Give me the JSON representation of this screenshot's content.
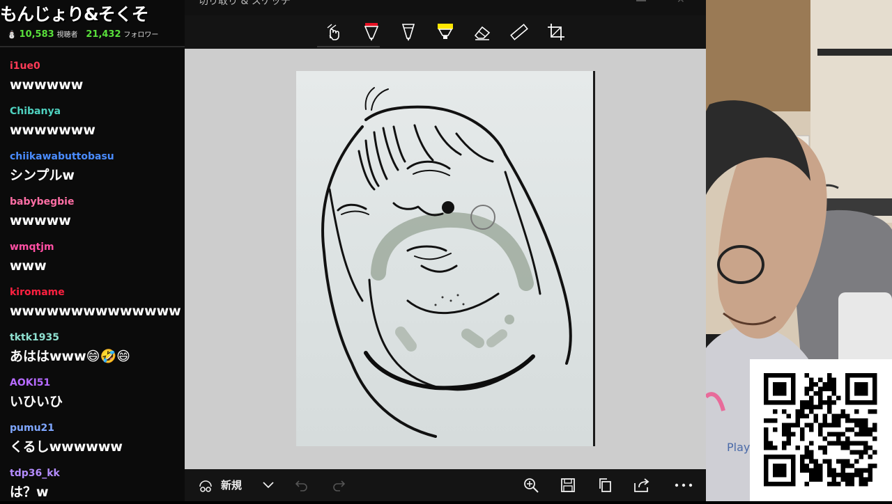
{
  "stream": {
    "title": "もんじょり&そくそ",
    "viewers": "10,583",
    "viewers_label": "視聴者",
    "followers": "21,432",
    "followers_label": "フォロワー"
  },
  "chat": [
    {
      "user": "i1ue0",
      "text": "wwwwww",
      "color": "#ff3b57"
    },
    {
      "user": "Chibanya",
      "text": "wwwwwww",
      "color": "#4fd2c0"
    },
    {
      "user": "chiikawabuttobasu",
      "text": "シンプルw",
      "color": "#4a8cff"
    },
    {
      "user": "babybegbie",
      "text": "wwwww",
      "color": "#ff6fa5"
    },
    {
      "user": "wmqtjm",
      "text": "www",
      "color": "#ff4fa3"
    },
    {
      "user": "kiromame",
      "text": "wwwwwwwwwwwwww",
      "color": "#ff2040"
    },
    {
      "user": "tktk1935",
      "text": "あははwww😄🤣😄",
      "color": "#8fe0d0"
    },
    {
      "user": "AOKI51",
      "text": "いひいひ",
      "color": "#b66bff"
    },
    {
      "user": "pumu21",
      "text": "くるしwwwwww",
      "color": "#7fa7ff"
    },
    {
      "user": "tdp36_kk",
      "text": "は？w",
      "color": "#b48cff"
    }
  ],
  "app": {
    "title": "切り取り & スケッチ",
    "tools": [
      "touch-writing-icon",
      "ballpoint-pen-icon",
      "pencil-icon",
      "highlighter-icon",
      "eraser-icon",
      "ruler-icon",
      "crop-icon"
    ],
    "bottom": {
      "new_label": "新規"
    },
    "accent_red": "#e81123",
    "accent_yellow": "#ffe600"
  },
  "webcam": {
    "sign_text": "PlaySta"
  }
}
